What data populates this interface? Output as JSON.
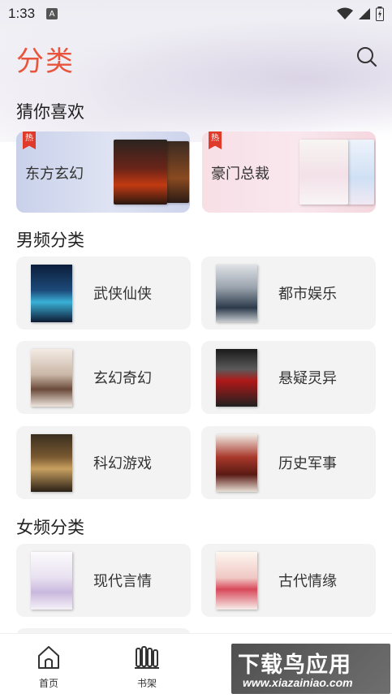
{
  "status_bar": {
    "time": "1:33",
    "notification_icon": "A"
  },
  "header": {
    "title": "分类"
  },
  "guess": {
    "title": "猜你喜欢",
    "cards": [
      {
        "label": "东方玄幻",
        "badge": "热"
      },
      {
        "label": "豪门总裁",
        "badge": "热"
      }
    ]
  },
  "male": {
    "title": "男频分类",
    "items": [
      {
        "label": "武侠仙侠"
      },
      {
        "label": "都市娱乐"
      },
      {
        "label": "玄幻奇幻"
      },
      {
        "label": "悬疑灵异"
      },
      {
        "label": "科幻游戏"
      },
      {
        "label": "历史军事"
      }
    ]
  },
  "female": {
    "title": "女频分类",
    "items": [
      {
        "label": "现代言情"
      },
      {
        "label": "古代情缘"
      }
    ]
  },
  "tabbar": {
    "items": [
      {
        "label": "首页"
      },
      {
        "label": "书架"
      }
    ]
  },
  "watermark": {
    "main": "下载鸟应用",
    "sub": "www.xiazainiao.com"
  },
  "colors": {
    "accent": "#e8553c",
    "hot_badge": "#e03a2a",
    "card_bg": "#f3f3f3"
  }
}
